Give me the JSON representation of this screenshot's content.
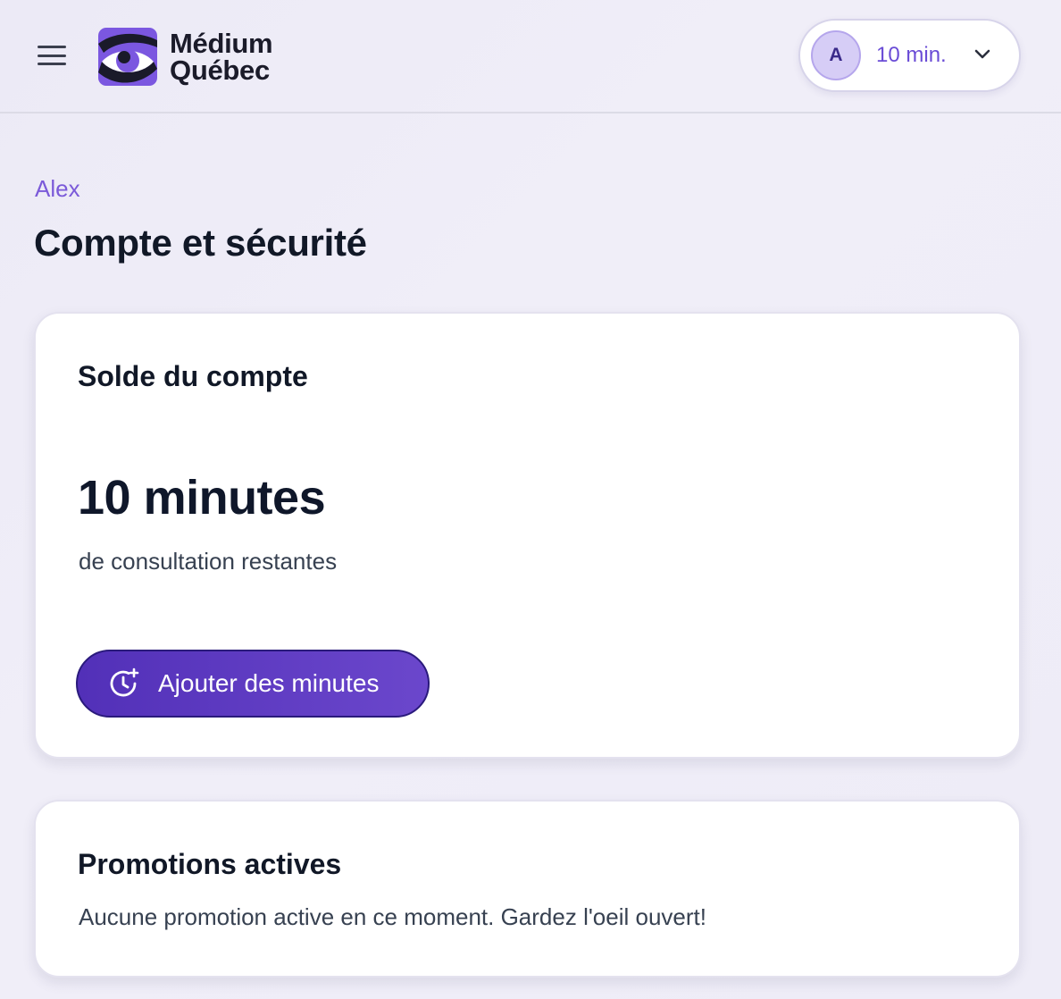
{
  "header": {
    "brand": {
      "line1": "Médium",
      "line2": "Québec"
    },
    "user": {
      "initial": "A",
      "minutes": "10 min."
    },
    "icons": [
      "menu-icon",
      "eye-logo-icon",
      "chevron-down-icon"
    ]
  },
  "breadcrumb": "Alex",
  "page_title": "Compte et sécurité",
  "balance_card": {
    "title": "Solde du compte",
    "value": "10 minutes",
    "subtitle": "de consultation restantes",
    "button_label": "Ajouter des minutes",
    "button_icon": "clock-plus-icon"
  },
  "promo_card": {
    "title": "Promotions actives",
    "text": "Aucune promotion active en ce moment. Gardez l'oeil ouvert!"
  },
  "colors": {
    "accent": "#6a4cd6",
    "button": "#5a38c0",
    "text": "#111827"
  }
}
